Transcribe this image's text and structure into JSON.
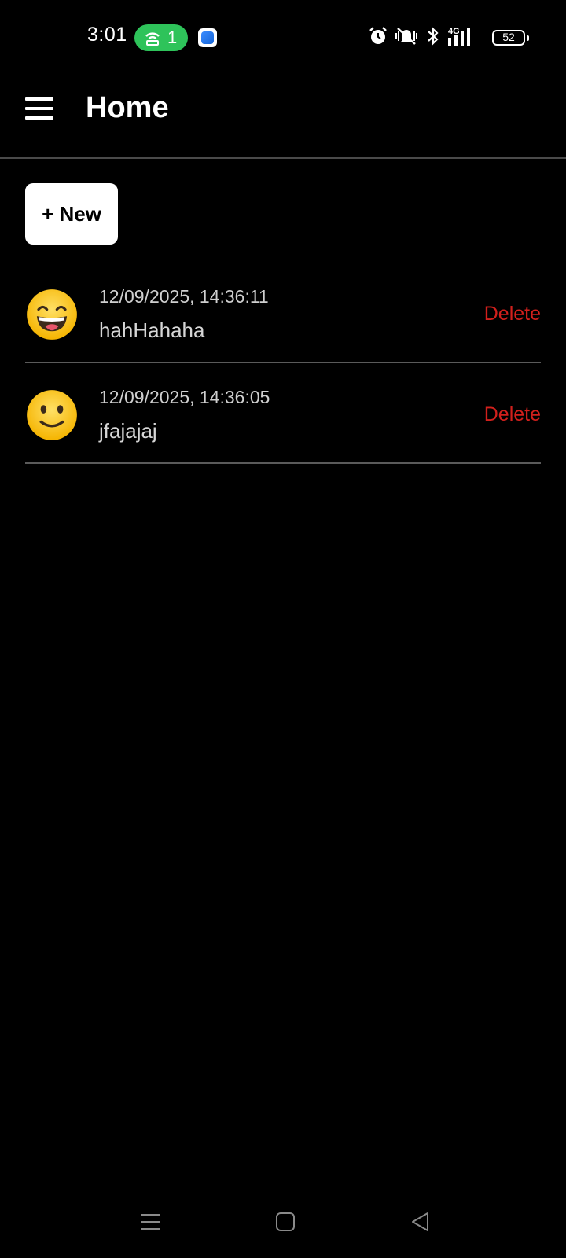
{
  "status_bar": {
    "time": "3:01",
    "hotspot_count": "1",
    "battery": "52",
    "network": "4G",
    "icons": [
      "hotspot-icon",
      "app-notification-icon",
      "alarm-icon",
      "vibrate-icon",
      "bluetooth-icon",
      "signal-icon",
      "battery-icon"
    ]
  },
  "app_bar": {
    "title": "Home",
    "menu_icon": "hamburger-menu-icon"
  },
  "new_button": {
    "label": "+ New"
  },
  "entries": [
    {
      "emoji": "grinning-face",
      "timestamp": "12/09/2025, 14:36:11",
      "text": "hahHahaha",
      "delete_label": "Delete"
    },
    {
      "emoji": "slightly-smiling-face",
      "timestamp": "12/09/2025, 14:36:05",
      "text": "jfajajaj",
      "delete_label": "Delete"
    }
  ],
  "nav_bar": {
    "buttons": [
      "recents-icon",
      "home-icon",
      "back-icon"
    ]
  },
  "colors": {
    "background": "#000000",
    "delete": "#d2201c",
    "hotspot": "#2ec35a",
    "divider": "#5a5a5a"
  }
}
